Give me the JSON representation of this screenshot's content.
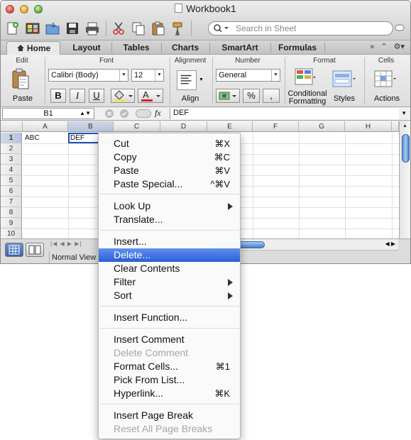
{
  "window": {
    "title": "Workbook1"
  },
  "search": {
    "placeholder": "Search in Sheet"
  },
  "ribbon_tabs": [
    "Home",
    "Layout",
    "Tables",
    "Charts",
    "SmartArt",
    "Formulas"
  ],
  "ribbon": {
    "groups": {
      "edit": "Edit",
      "font": "Font",
      "alignment": "Alignment",
      "number": "Number",
      "format": "Format",
      "cells": "Cells"
    },
    "paste_label": "Paste",
    "font_name": "Calibri (Body)",
    "font_size": "12",
    "bold": "B",
    "italic": "I",
    "underline": "U",
    "align_label": "Align",
    "number_format": "General",
    "percent": "%",
    "comma": ",",
    "conditional_formatting_1": "Conditional",
    "conditional_formatting_2": "Formatting",
    "styles_label": "Styles",
    "actions_label": "Actions",
    "fx": "fx"
  },
  "formula_bar": {
    "name_box": "B1",
    "content": "DEF"
  },
  "columns": [
    "A",
    "B",
    "C",
    "D",
    "E",
    "F",
    "G",
    "H"
  ],
  "rows": [
    "1",
    "2",
    "3",
    "4",
    "5",
    "6",
    "7",
    "8",
    "9",
    "10"
  ],
  "cells": {
    "A1": "ABC",
    "B1": "DEF"
  },
  "status": {
    "view": "Normal View"
  },
  "context_menu": [
    {
      "label": "Cut",
      "shortcut": "⌘X"
    },
    {
      "label": "Copy",
      "shortcut": "⌘C"
    },
    {
      "label": "Paste",
      "shortcut": "⌘V"
    },
    {
      "label": "Paste Special...",
      "shortcut": "^⌘V"
    },
    {
      "label": "Look Up",
      "submenu": true
    },
    {
      "label": "Translate..."
    },
    {
      "label": "Insert..."
    },
    {
      "label": "Delete...",
      "highlighted": true
    },
    {
      "label": "Clear Contents"
    },
    {
      "label": "Filter",
      "submenu": true
    },
    {
      "label": "Sort",
      "submenu": true
    },
    {
      "label": "Insert Function..."
    },
    {
      "label": "Insert Comment"
    },
    {
      "label": "Delete Comment",
      "disabled": true
    },
    {
      "label": "Format Cells...",
      "shortcut": "⌘1"
    },
    {
      "label": "Pick From List..."
    },
    {
      "label": "Hyperlink...",
      "shortcut": "⌘K"
    },
    {
      "label": "Insert Page Break"
    },
    {
      "label": "Reset All Page Breaks",
      "disabled": true
    }
  ],
  "colors": {
    "selection": "#1f4fb4",
    "menu_highlight": "#2a5fd6",
    "red": "#e0443a",
    "yellow": "#e6a21f",
    "green": "#5fa83a"
  }
}
